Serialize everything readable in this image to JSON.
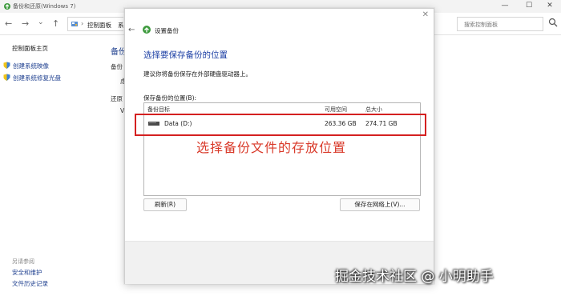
{
  "window": {
    "title": "备份和还原(Windows 7)",
    "controls": {
      "minimize": "—",
      "maximize": "☐",
      "close": "✕"
    }
  },
  "address": {
    "back": "←",
    "forward": "→",
    "dropdown": "⌄",
    "up": "↑",
    "separator": "›",
    "crumbs": [
      "控制面板",
      "系"
    ],
    "search_placeholder": "搜索控制面板"
  },
  "sidebar": {
    "home": "控制面板主页",
    "links": [
      "创建系统映像",
      "创建系统修复光盘"
    ],
    "see_also": "另请参阅",
    "bottom_links": [
      "安全和维护",
      "文件历史记录"
    ]
  },
  "background_main": {
    "heading": "备份",
    "fragments": [
      "备份",
      "虑",
      "还原",
      "V"
    ]
  },
  "dialog": {
    "close": "✕",
    "back": "←",
    "title": "设置备份",
    "heading": "选择要保存备份的位置",
    "subtitle": "建议你将备份保存在外部硬盘驱动器上。",
    "list_label": "保存备份的位置(B):",
    "columns": [
      "备份目标",
      "可用空间",
      "总大小"
    ],
    "rows": [
      {
        "name": "Data (D:)",
        "free": "263.36 GB",
        "total": "274.71 GB"
      }
    ],
    "refresh_button": "刷新(R)",
    "network_button": "保存在网络上(V)..."
  },
  "annotation": "选择备份文件的存放位置",
  "watermark": "掘金技术社区 @ 小明助手",
  "colors": {
    "link": "#1e3f8f",
    "heading": "#1c3fa4",
    "highlight": "#d42020",
    "annotation": "#d93a2a"
  }
}
